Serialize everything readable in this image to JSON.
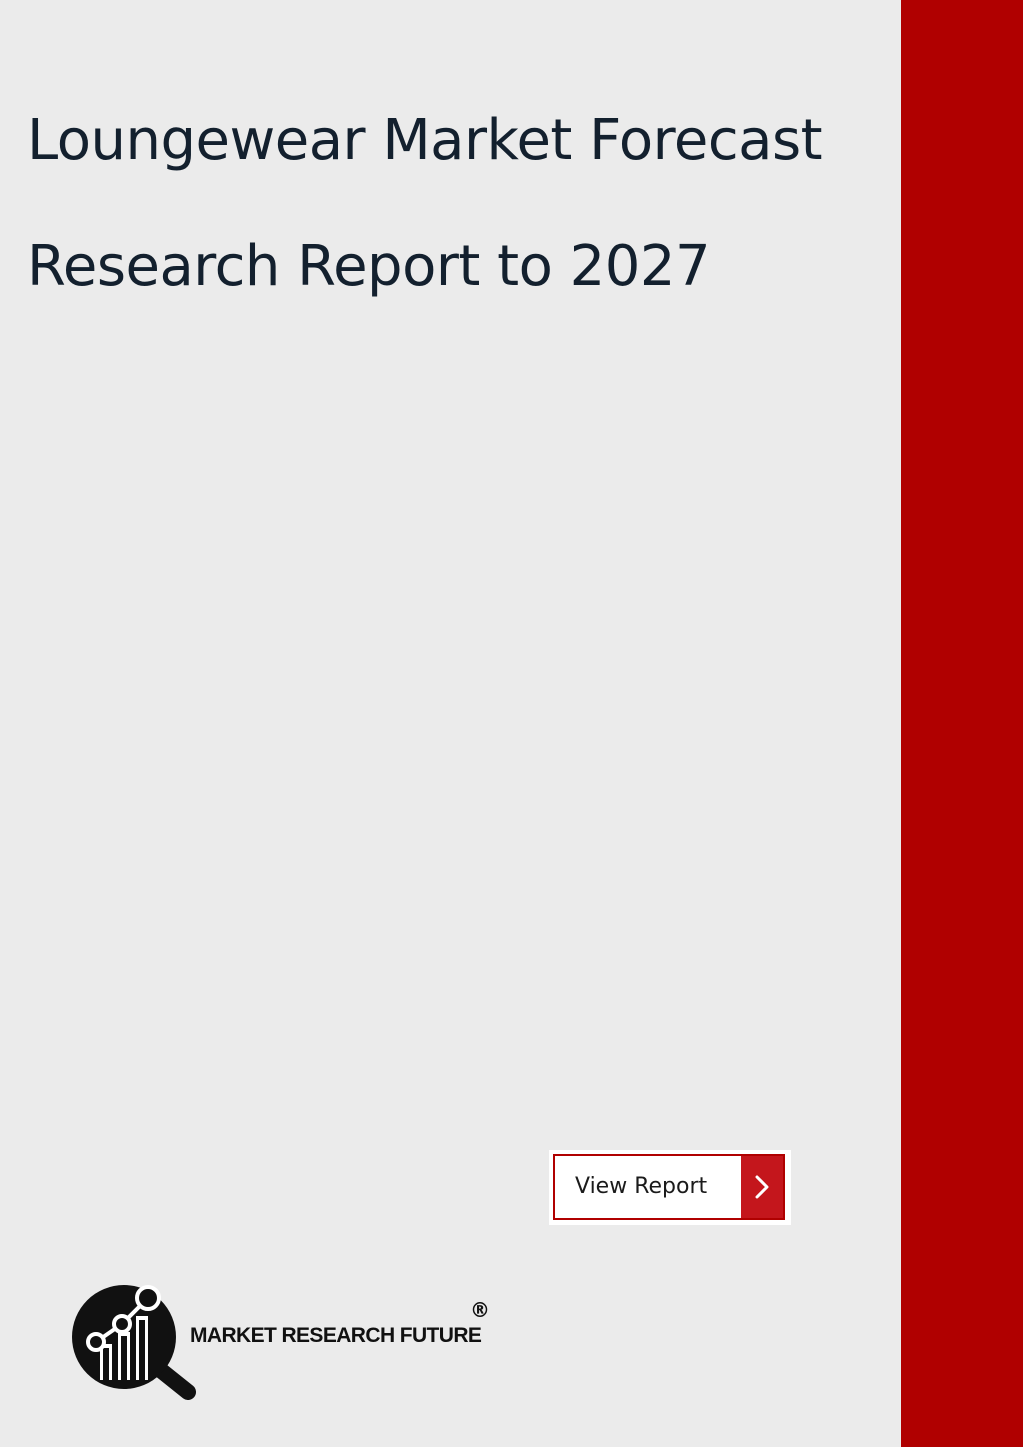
{
  "document": {
    "title_line_1": "Loungewear Market Forecast",
    "title_line_2": "Research Report to 2027"
  },
  "cta": {
    "label": "View Report",
    "arrow_icon": "chevron-right-icon"
  },
  "brand": {
    "name": "MARKET RESEARCH FUTURE",
    "registered_mark": "®",
    "logo_icon": "magnifier-chart-icon"
  },
  "colors": {
    "background": "#ebebeb",
    "accent_red": "#b00000",
    "button_red": "#c4161c",
    "title_text": "#13202e"
  }
}
